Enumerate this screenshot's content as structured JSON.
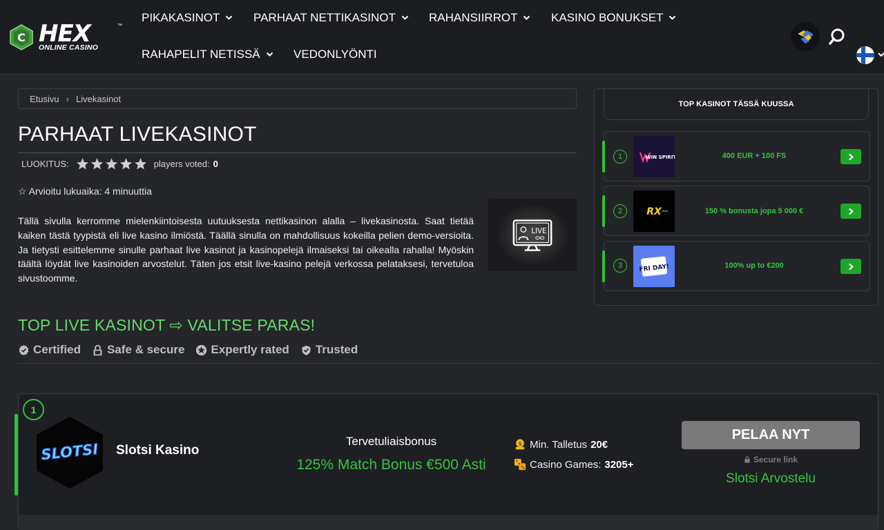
{
  "header": {
    "logo": {
      "brand": "HEX",
      "tagline": "ONLINE CASINO"
    },
    "nav": [
      {
        "label": "PIKAKASINOT",
        "has_dropdown": true
      },
      {
        "label": "PARHAAT NETTIKASINOT",
        "has_dropdown": true
      },
      {
        "label": "RAHANSIIRROT",
        "has_dropdown": true
      },
      {
        "label": "KASINO BONUKSET",
        "has_dropdown": true
      },
      {
        "label": "RAHAPELIT NETISSÄ",
        "has_dropdown": true
      },
      {
        "label": "VEDONLYÖNTI",
        "has_dropdown": false
      }
    ],
    "icons": [
      "ukraine-support-icon",
      "search-icon",
      "finland-flag-icon"
    ]
  },
  "breadcrumb": {
    "home": "Etusivu",
    "separator": "›",
    "current": "Livekasinot"
  },
  "page": {
    "title": "PARHAAT LIVEKASINOT",
    "rating": {
      "label": "LUOKITUS:",
      "stars": 5,
      "votes_text": "players voted:",
      "votes": "0"
    },
    "read_time": "☆ Arvioitu lukuaika: 4 minuuttia",
    "intro": "Tällä sivulla kerromme mielenkiintoisesta uutuuksesta nettikasinon alalla – livekasinosta. Saat tietää kaiken tästä tyypistä eli live kasino ilmiöstä. Täällä sinulla on mahdollisuus kokeilla pelien demo-versioita. Ja tietysti esittelemme sinulle parhaat live kasinot ja kasinopelejä ilmaiseksi tai oikealla rahalla! Myöskin täältä löydät live kasinoiden arvostelut. Täten jos etsit live-kasino pelejä verkossa pelataksesi, tervetuloa sivustoomme.",
    "image_text": "LIVE"
  },
  "section": {
    "title": "TOP LIVE KASINOT ⇨ VALITSE PARAS!",
    "badges": [
      "Certified",
      "Safe & secure",
      "Expertly rated",
      "Trusted"
    ]
  },
  "casino_card": {
    "rank": "1",
    "logo_text": "SLOTSI",
    "name": "Slotsi Kasino",
    "bonus_label": "Tervetuliaisbonus",
    "bonus_value": "125% Match Bonus €500 Asti",
    "min_deposit_label": "Min. Talletus",
    "min_deposit_value": "20€",
    "games_label": "Casino Games:",
    "games_value": "3205+",
    "play_label": "PELAA NYT",
    "secure_label": "Secure link",
    "review_label": "Slotsi Arvostelu"
  },
  "sidebar": {
    "title": "TOP KASINOT TÄSSÄ KUUSSA",
    "items": [
      {
        "rank": "1",
        "logo_text": "WIN SPIRIT",
        "bonus": "400 EUR + 100 FS"
      },
      {
        "rank": "2",
        "logo_text": "RX",
        "bonus": "150 % bonusta jopa 5 000 €"
      },
      {
        "rank": "3",
        "logo_text": "FRI DAY!",
        "bonus": "100% up to €200"
      }
    ]
  },
  "colors": {
    "accent_green": "#35c441",
    "section_green": "#67d96f",
    "header_bg": "#1c1d20",
    "page_bg": "#25262a"
  }
}
